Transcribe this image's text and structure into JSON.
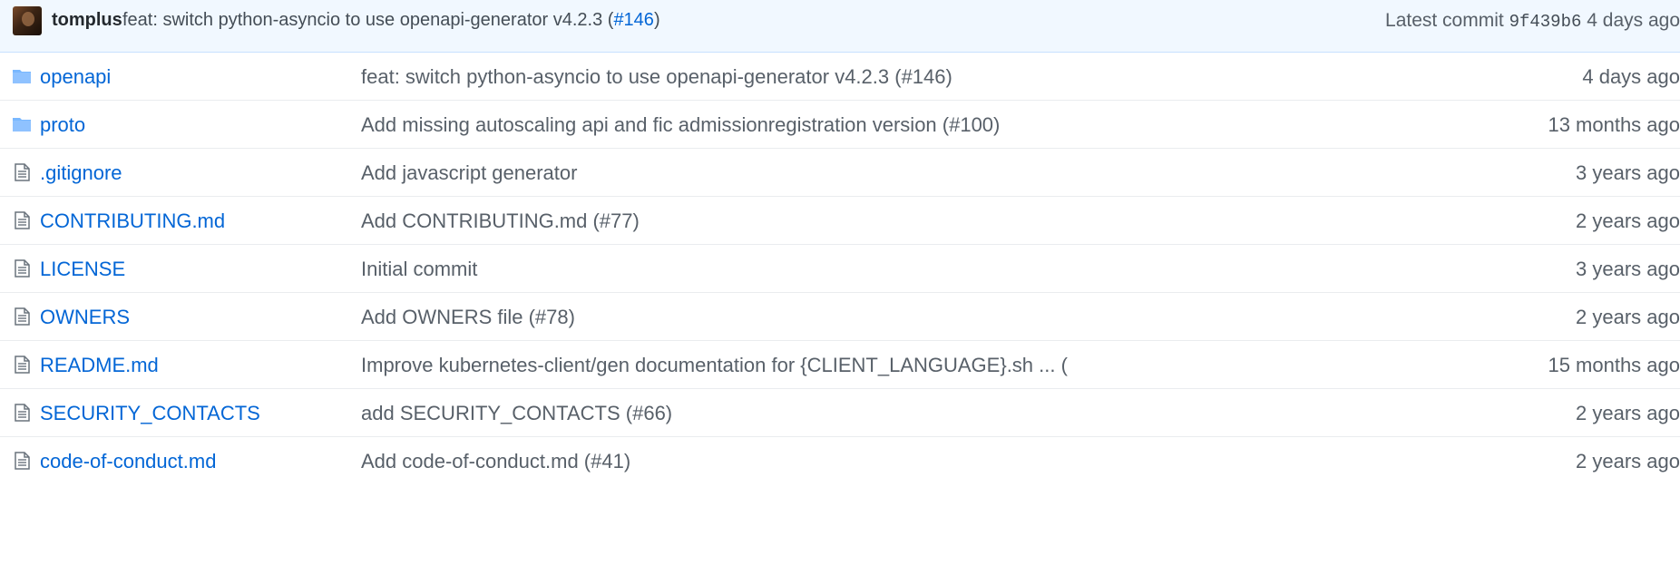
{
  "latest_commit": {
    "author": "tomplus",
    "message": "feat: switch python-asyncio to use openapi-generator v4.2.3 (",
    "pr_ref": "#146",
    "message_suffix": ")",
    "label": "Latest commit",
    "sha": "9f439b6",
    "age": "4 days ago"
  },
  "files": [
    {
      "name": "openapi",
      "type": "folder",
      "message": "feat: switch python-asyncio to use openapi-generator v4.2.3 (#146)",
      "age": "4 days ago"
    },
    {
      "name": "proto",
      "type": "folder",
      "message": "Add missing autoscaling api and fic admissionregistration version (#100)",
      "age": "13 months ago"
    },
    {
      "name": ".gitignore",
      "type": "file",
      "message": "Add javascript generator",
      "age": "3 years ago"
    },
    {
      "name": "CONTRIBUTING.md",
      "type": "file",
      "message": "Add CONTRIBUTING.md (#77)",
      "age": "2 years ago"
    },
    {
      "name": "LICENSE",
      "type": "file",
      "message": "Initial commit",
      "age": "3 years ago"
    },
    {
      "name": "OWNERS",
      "type": "file",
      "message": "Add OWNERS file (#78)",
      "age": "2 years ago"
    },
    {
      "name": "README.md",
      "type": "file",
      "message": "Improve kubernetes-client/gen documentation for {CLIENT_LANGUAGE}.sh ... (",
      "age": "15 months ago"
    },
    {
      "name": "SECURITY_CONTACTS",
      "type": "file",
      "message": "add SECURITY_CONTACTS (#66)",
      "age": "2 years ago"
    },
    {
      "name": "code-of-conduct.md",
      "type": "file",
      "message": "Add code-of-conduct.md (#41)",
      "age": "2 years ago"
    }
  ],
  "icons": {
    "folder": "folder-icon",
    "file": "file-icon"
  },
  "colors": {
    "link": "#0366d6",
    "folder_icon": "#79b8ff",
    "file_icon": "#6a737d",
    "commit_bar_bg": "#f1f8ff",
    "muted_text": "#586069"
  }
}
